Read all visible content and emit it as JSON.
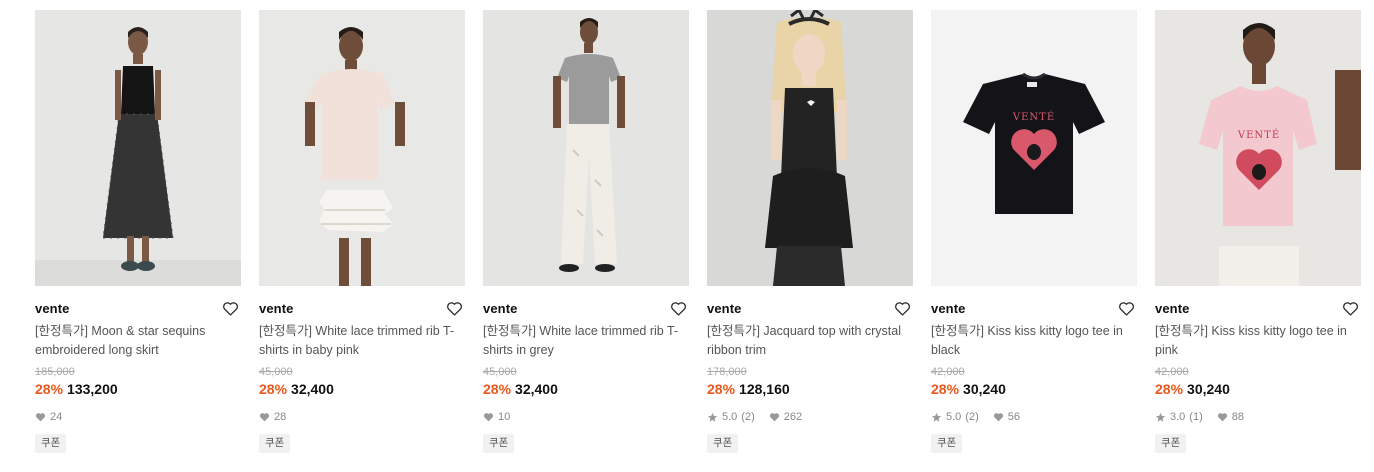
{
  "products": [
    {
      "brand": "vente",
      "title": "[한정특가] Moon & star sequins embroidered long skirt",
      "original_price": "185,000",
      "discount": "28%",
      "price": "133,200",
      "rating": "",
      "reviews": "",
      "likes": "24",
      "badge": "쿠폰"
    },
    {
      "brand": "vente",
      "title": "[한정특가] White lace trimmed rib T-shirts in baby pink",
      "original_price": "45,000",
      "discount": "28%",
      "price": "32,400",
      "rating": "",
      "reviews": "",
      "likes": "28",
      "badge": "쿠폰"
    },
    {
      "brand": "vente",
      "title": "[한정특가] White lace trimmed rib T-shirts in grey",
      "original_price": "45,000",
      "discount": "28%",
      "price": "32,400",
      "rating": "",
      "reviews": "",
      "likes": "10",
      "badge": "쿠폰"
    },
    {
      "brand": "vente",
      "title": "[한정특가] Jacquard top with crystal ribbon trim",
      "original_price": "178,000",
      "discount": "28%",
      "price": "128,160",
      "rating": "5.0",
      "reviews": "(2)",
      "likes": "262",
      "badge": "쿠폰"
    },
    {
      "brand": "vente",
      "title": "[한정특가] Kiss kiss kitty logo tee in black",
      "original_price": "42,000",
      "discount": "28%",
      "price": "30,240",
      "rating": "5.0",
      "reviews": "(2)",
      "likes": "56",
      "badge": "쿠폰"
    },
    {
      "brand": "vente",
      "title": "[한정특가] Kiss kiss kitty logo tee in pink",
      "original_price": "42,000",
      "discount": "28%",
      "price": "30,240",
      "rating": "3.0",
      "reviews": "(1)",
      "likes": "88",
      "badge": "쿠폰"
    }
  ],
  "icons": {
    "wishlist": "heart-outline-icon",
    "likes": "heart-filled-icon",
    "rating": "star-icon"
  },
  "colors": {
    "discount": "#e8591a",
    "brand_text": "#111111",
    "muted": "#888888"
  }
}
